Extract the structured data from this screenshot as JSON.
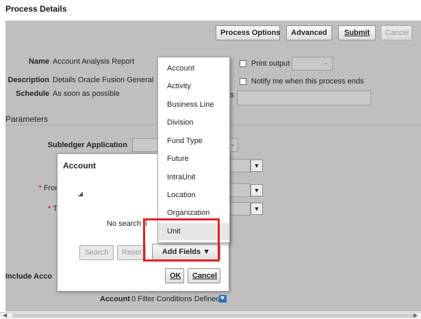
{
  "page_title": "Process Details",
  "toolbar": {
    "process_options": "Process Options",
    "advanced": "Advanced",
    "submit": "Submit",
    "cancel": "Cancel"
  },
  "details": {
    "name_label": "Name",
    "name_value": "Account Analysis Report",
    "description_label": "Description",
    "description_value": "Details Oracle Fusion General",
    "schedule_label": "Schedule",
    "schedule_value": "As soon as possible",
    "print_output": "Print output",
    "notify": "Notify me when this process ends",
    "partial_label_fragment": "s"
  },
  "parameters": {
    "section_title": "Parameters",
    "subledger_application": "Subledger Application",
    "from_label_fragment": "Fror",
    "to_label_fragment": "T",
    "include_label_fragment": "Include Acco",
    "required_marker": "*"
  },
  "account_panel": {
    "title": "Account",
    "no_search_fragment": "No search fi",
    "search": "Search",
    "reset": "Reset",
    "add_fields": "Add Fields",
    "ok": "OK",
    "cancel": "Cancel"
  },
  "add_fields_menu": {
    "items": [
      "Account",
      "Activity",
      "Business Line",
      "Division",
      "Fund Type",
      "Future",
      "IntraUnit",
      "Location",
      "Organization",
      "Unit"
    ],
    "selected": "Unit"
  },
  "filter_row": {
    "label": "Account",
    "value": "0 Filter Conditions Defined"
  },
  "icons": {
    "dropdown": "chevron-down-icon",
    "filter": "filter-icon",
    "collapse": "triangle-icon",
    "add_fields_arrow": "caret-down-icon"
  },
  "colors": {
    "overlay": "#bfbfbf",
    "highlight_border": "#e01f26",
    "filter_icon": "#2d6fc0"
  }
}
